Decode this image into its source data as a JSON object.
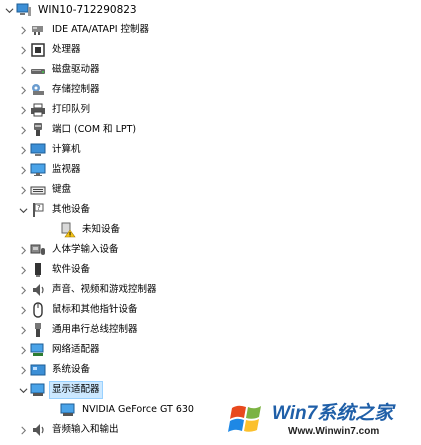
{
  "tree": {
    "root": "WIN10-712290823",
    "items": [
      {
        "label": "IDE ATA/ATAPI 控制器"
      },
      {
        "label": "处理器"
      },
      {
        "label": "磁盘驱动器"
      },
      {
        "label": "存储控制器"
      },
      {
        "label": "打印队列"
      },
      {
        "label": "端口 (COM 和 LPT)"
      },
      {
        "label": "计算机"
      },
      {
        "label": "监视器"
      },
      {
        "label": "键盘"
      },
      {
        "label": "其他设备"
      },
      {
        "label": "未知设备"
      },
      {
        "label": "人体学输入设备"
      },
      {
        "label": "软件设备"
      },
      {
        "label": "声音、视频和游戏控制器"
      },
      {
        "label": "鼠标和其他指针设备"
      },
      {
        "label": "通用串行总线控制器"
      },
      {
        "label": "网络适配器"
      },
      {
        "label": "系统设备"
      },
      {
        "label": "显示适配器"
      },
      {
        "label": "NVIDIA GeForce GT 630"
      },
      {
        "label": "音频输入和输出"
      }
    ]
  },
  "watermark": {
    "brand": "Win7系统之家",
    "url": "Www.Winwin7.com"
  },
  "colors": {
    "selection": "#cce8ff",
    "accent": "#1f5fa8"
  }
}
